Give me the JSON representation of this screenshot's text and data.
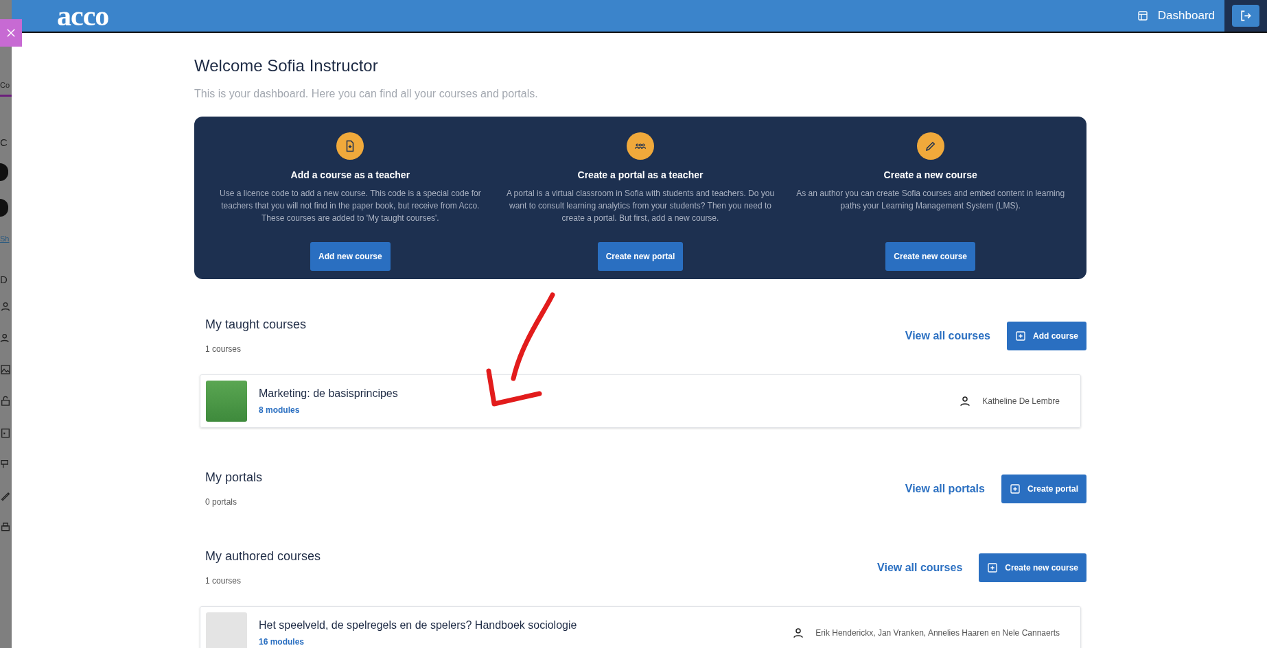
{
  "background_page": {
    "tab": "Co",
    "heading": "C",
    "link": "Sh",
    "heading_2": "D"
  },
  "topbar": {
    "logo": "acco",
    "nav_link": "Dashboard"
  },
  "welcome": {
    "title": "Welcome Sofia Instructor",
    "subtitle": "This is your dashboard. Here you can find all your courses and portals."
  },
  "actions": [
    {
      "title": "Add a course as a teacher",
      "text": "Use a licence code to add a new course. This code is a special code for teachers that you will not find in the paper book, but receive from Acco. These courses are added to 'My taught courses'.",
      "button": "Add new course"
    },
    {
      "title": "Create a portal as a teacher",
      "text": "A portal is a virtual classroom in Sofia with students and teachers. Do you want to consult learning analytics from your students? Then you need to create a portal. But first, add a new course.",
      "button": "Create new portal"
    },
    {
      "title": "Create a new course",
      "text": "As an author you can create Sofia courses and embed content in learning paths your Learning Management System (LMS).",
      "button": "Create new course"
    }
  ],
  "sections": [
    {
      "title": "My taught courses",
      "count": "1 courses",
      "view_all": "View all courses",
      "button": "Add course",
      "courses": [
        {
          "title": "Marketing: de basisprincipes",
          "modules": "8 modules",
          "authors": "Katheline De Lembre",
          "kind": "photo"
        }
      ]
    },
    {
      "title": "My portals",
      "count": "0 portals",
      "view_all": "View all portals",
      "button": "Create portal"
    },
    {
      "title": "My authored courses",
      "count": "1 courses",
      "view_all": "View all courses",
      "button": "Create new course",
      "courses": [
        {
          "title": "Het speelveld, de spelregels en de spelers? Handboek sociologie",
          "modules": "16 modules",
          "authors": "Erik Henderickx, Jan Vranken, Annelies Haaren en Nele Cannaerts",
          "kind": "illustration"
        }
      ]
    }
  ]
}
